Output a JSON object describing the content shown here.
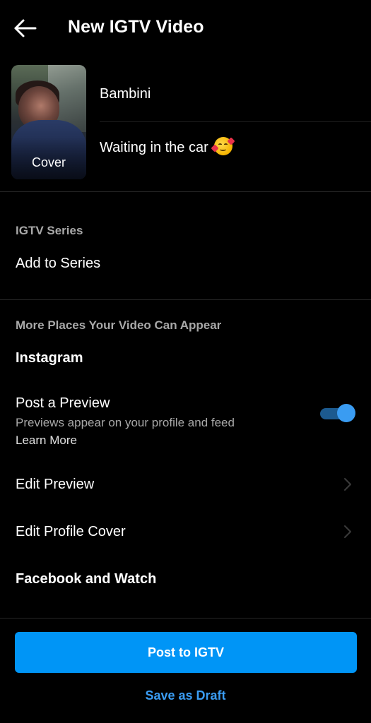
{
  "header": {
    "title": "New IGTV Video",
    "back_icon": "arrow-left-icon"
  },
  "media": {
    "cover_label": "Cover",
    "title_value": "Bambini",
    "description_value": "Waiting in the car",
    "description_emoji": "smiling-face-with-hearts"
  },
  "series": {
    "section_label": "IGTV Series",
    "add_label": "Add to Series"
  },
  "more_places": {
    "section_label": "More Places Your Video Can Appear",
    "instagram_heading": "Instagram",
    "post_preview": {
      "label": "Post a Preview",
      "description": "Previews appear on your profile and feed",
      "learn_more": "Learn More",
      "enabled": true
    },
    "edit_preview_label": "Edit Preview",
    "edit_profile_cover_label": "Edit Profile Cover",
    "facebook_heading": "Facebook and Watch"
  },
  "actions": {
    "post_label": "Post to IGTV",
    "draft_label": "Save as Draft"
  },
  "colors": {
    "background": "#000000",
    "accent": "#0095f6",
    "link_blue": "#3a9cf2",
    "secondary_text": "#a8a8a8"
  }
}
